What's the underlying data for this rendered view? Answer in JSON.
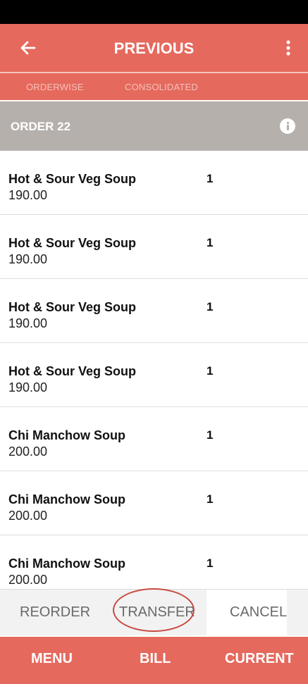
{
  "header": {
    "title": "PREVIOUS",
    "back_icon": "arrow-left-icon",
    "menu_icon": "more-vert-icon"
  },
  "tabs": [
    {
      "label": "ORDERWISE"
    },
    {
      "label": "CONSOLIDATED"
    }
  ],
  "order": {
    "title": "ORDER 22",
    "info_icon": "info-icon"
  },
  "items": [
    {
      "name": "Hot & Sour Veg Soup",
      "price": "190.00",
      "qty": "1"
    },
    {
      "name": "Hot & Sour Veg Soup",
      "price": "190.00",
      "qty": "1"
    },
    {
      "name": "Hot & Sour Veg Soup",
      "price": "190.00",
      "qty": "1"
    },
    {
      "name": "Hot & Sour Veg Soup",
      "price": "190.00",
      "qty": "1"
    },
    {
      "name": "Chi Manchow Soup",
      "price": "200.00",
      "qty": "1"
    },
    {
      "name": "Chi Manchow Soup",
      "price": "200.00",
      "qty": "1"
    },
    {
      "name": "Chi Manchow Soup",
      "price": "200.00",
      "qty": "1"
    }
  ],
  "actions": {
    "reorder": "REORDER",
    "transfer": "TRANSFER",
    "cancel": "CANCEL"
  },
  "bottom_nav": {
    "menu": "MENU",
    "bill": "BILL",
    "current": "CURRENT"
  },
  "colors": {
    "primary": "#e5695d",
    "order_bar": "#b6b0ac",
    "annotation": "#c84a3f"
  }
}
